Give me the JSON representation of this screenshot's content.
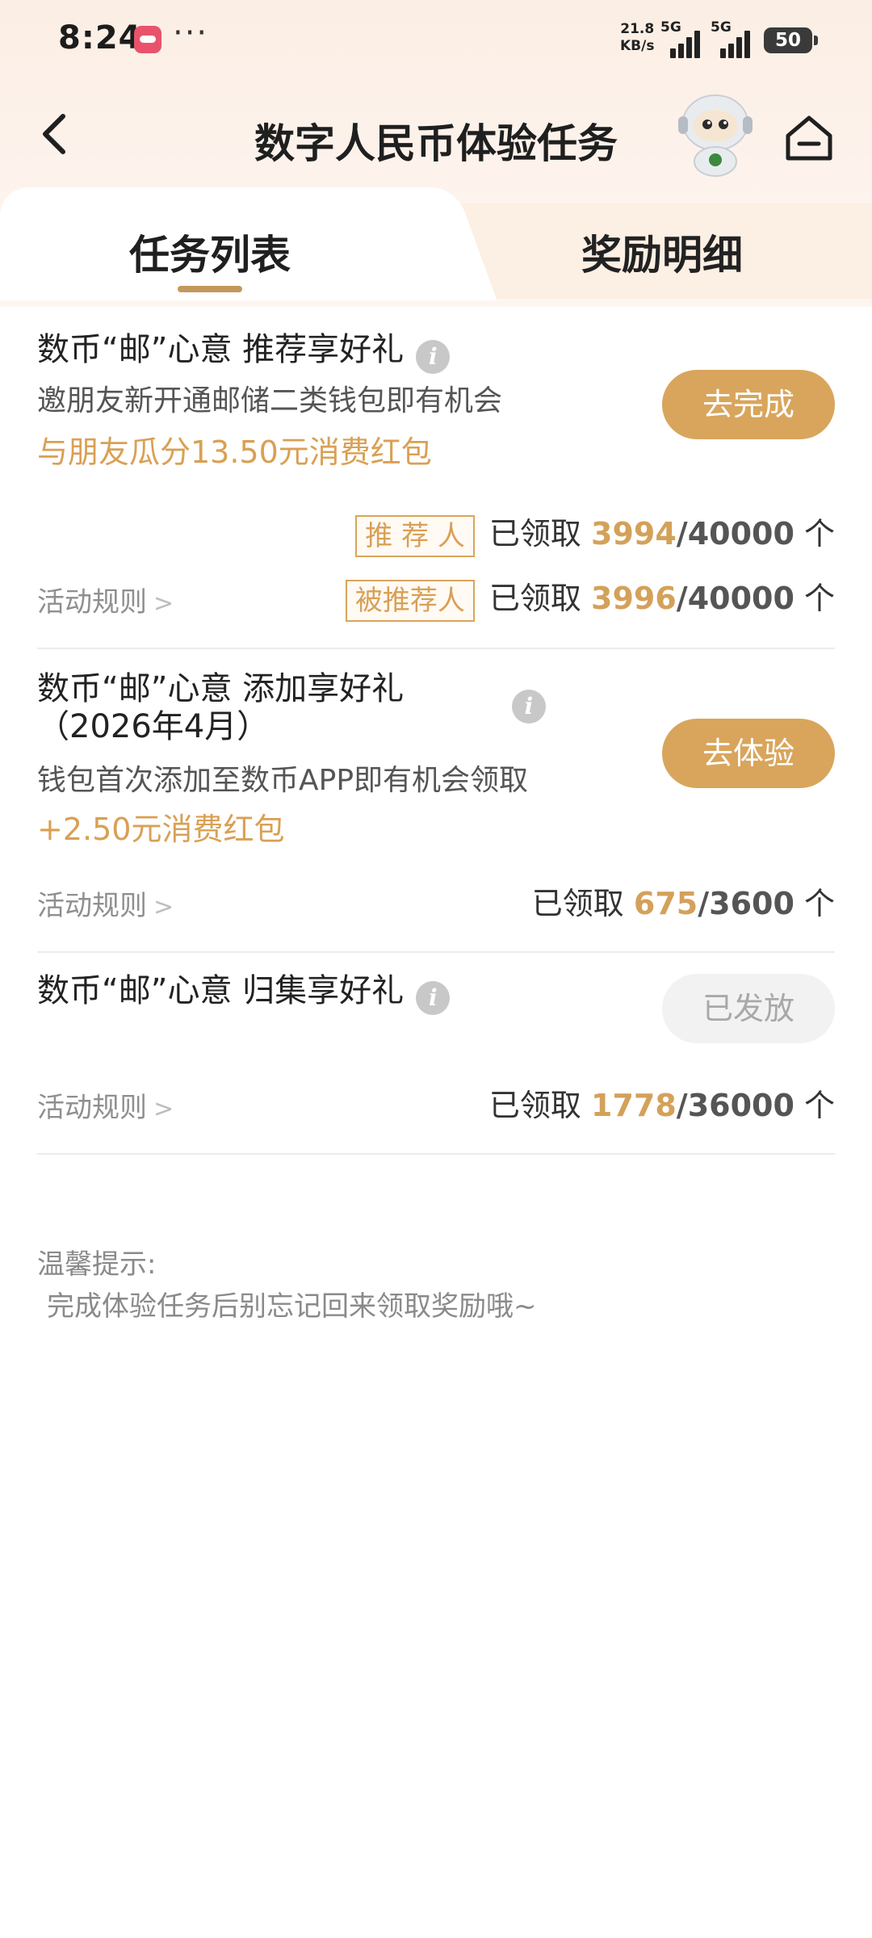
{
  "status_bar": {
    "time": "8:24",
    "more": "···",
    "net_speed_value": "21.8",
    "net_speed_unit": "KB/s",
    "network1": "5G",
    "network2": "5G",
    "battery": "50"
  },
  "nav": {
    "title": "数字人民币体验任务",
    "back_icon": "chevron-left-icon",
    "home_icon": "home-icon",
    "mascot_icon": "robot-mascot-icon"
  },
  "tabs": [
    {
      "label": "任务列表",
      "active": true
    },
    {
      "label": "奖励明细",
      "active": false
    }
  ],
  "tasks": [
    {
      "title": "数币“邮”心意 推荐享好礼",
      "desc": "邀朋友新开通邮储二类钱包即有机会",
      "reward": "与朋友瓜分13.50元消费红包",
      "button": "去完成",
      "rules": "活动规则",
      "stats": [
        {
          "role": "推 荐 人",
          "prefix": "已领取",
          "claimed": "3994",
          "total": "40000",
          "unit": "个"
        },
        {
          "role": "被推荐人",
          "prefix": "已领取",
          "claimed": "3996",
          "total": "40000",
          "unit": "个"
        }
      ]
    },
    {
      "title_line1": "数币“邮”心意 添加享好礼",
      "title_line2": "（2026年4月）",
      "desc": "钱包首次添加至数币APP即有机会领取",
      "reward": "+2.50元消费红包",
      "button": "去体验",
      "rules": "活动规则",
      "stat": {
        "prefix": "已领取",
        "claimed": "675",
        "total": "3600",
        "unit": "个"
      }
    },
    {
      "title": "数币“邮”心意 归集享好礼",
      "button": "已发放",
      "rules": "活动规则",
      "stat": {
        "prefix": "已领取",
        "claimed": "1778",
        "total": "36000",
        "unit": "个"
      }
    }
  ],
  "tips": {
    "title": "温馨提示:",
    "text": "完成体验任务后别忘记回来领取奖励哦~"
  },
  "colors": {
    "accent": "#d9a55c",
    "accent_text": "#d4a15a",
    "disabled_bg": "#f2f2f2",
    "divider": "#ececec"
  }
}
